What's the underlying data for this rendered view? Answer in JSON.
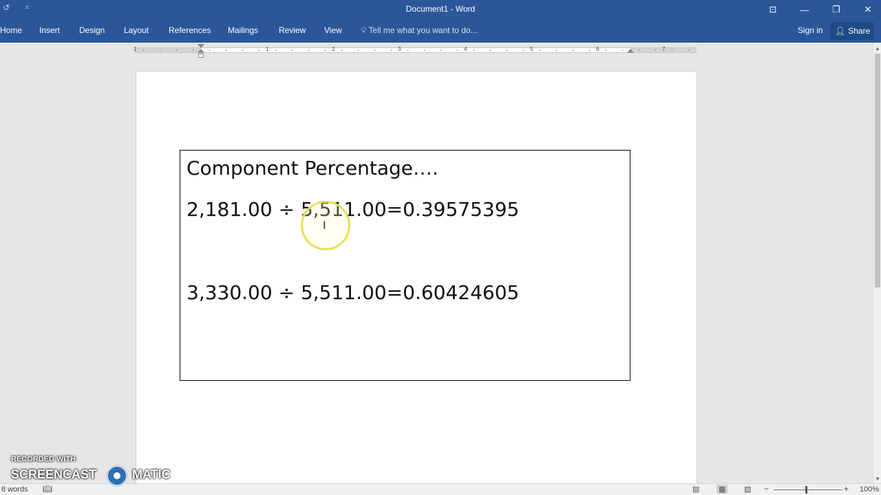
{
  "window": {
    "title": "Document1 - Word",
    "quick_access": {
      "undo_glyph": "↺",
      "customize_glyph": "⩡"
    },
    "buttons": {
      "ribbon_display": "⊡",
      "minimize": "—",
      "restore": "❐",
      "close": "✕"
    }
  },
  "ribbon": {
    "tabs": [
      "Home",
      "Insert",
      "Design",
      "Layout",
      "References",
      "Mailings",
      "Review",
      "View"
    ],
    "tell_me": "Tell me what you want to do...",
    "sign_in": "Sign in",
    "share": "Share"
  },
  "ruler": {
    "numbers": [
      "1",
      "1",
      "2",
      "3",
      "4",
      "5",
      "6",
      "7"
    ]
  },
  "document": {
    "heading": "Component Percentage….",
    "equation_1": "2,181.00 ÷ 5,511.00=0.39575395",
    "equation_2": "3,330.00 ÷ 5,511.00=0.60424605",
    "ibeam": "I"
  },
  "status_bar": {
    "word_count": "8 words",
    "zoom_minus": "−",
    "zoom_plus": "+",
    "zoom_level": "100%"
  },
  "watermark": {
    "top": "RECORDED WITH",
    "left": "SCREENCAST",
    "right": "MATIC"
  },
  "colors": {
    "accent": "#2b579a",
    "cursor_highlight": "#e8de59"
  }
}
